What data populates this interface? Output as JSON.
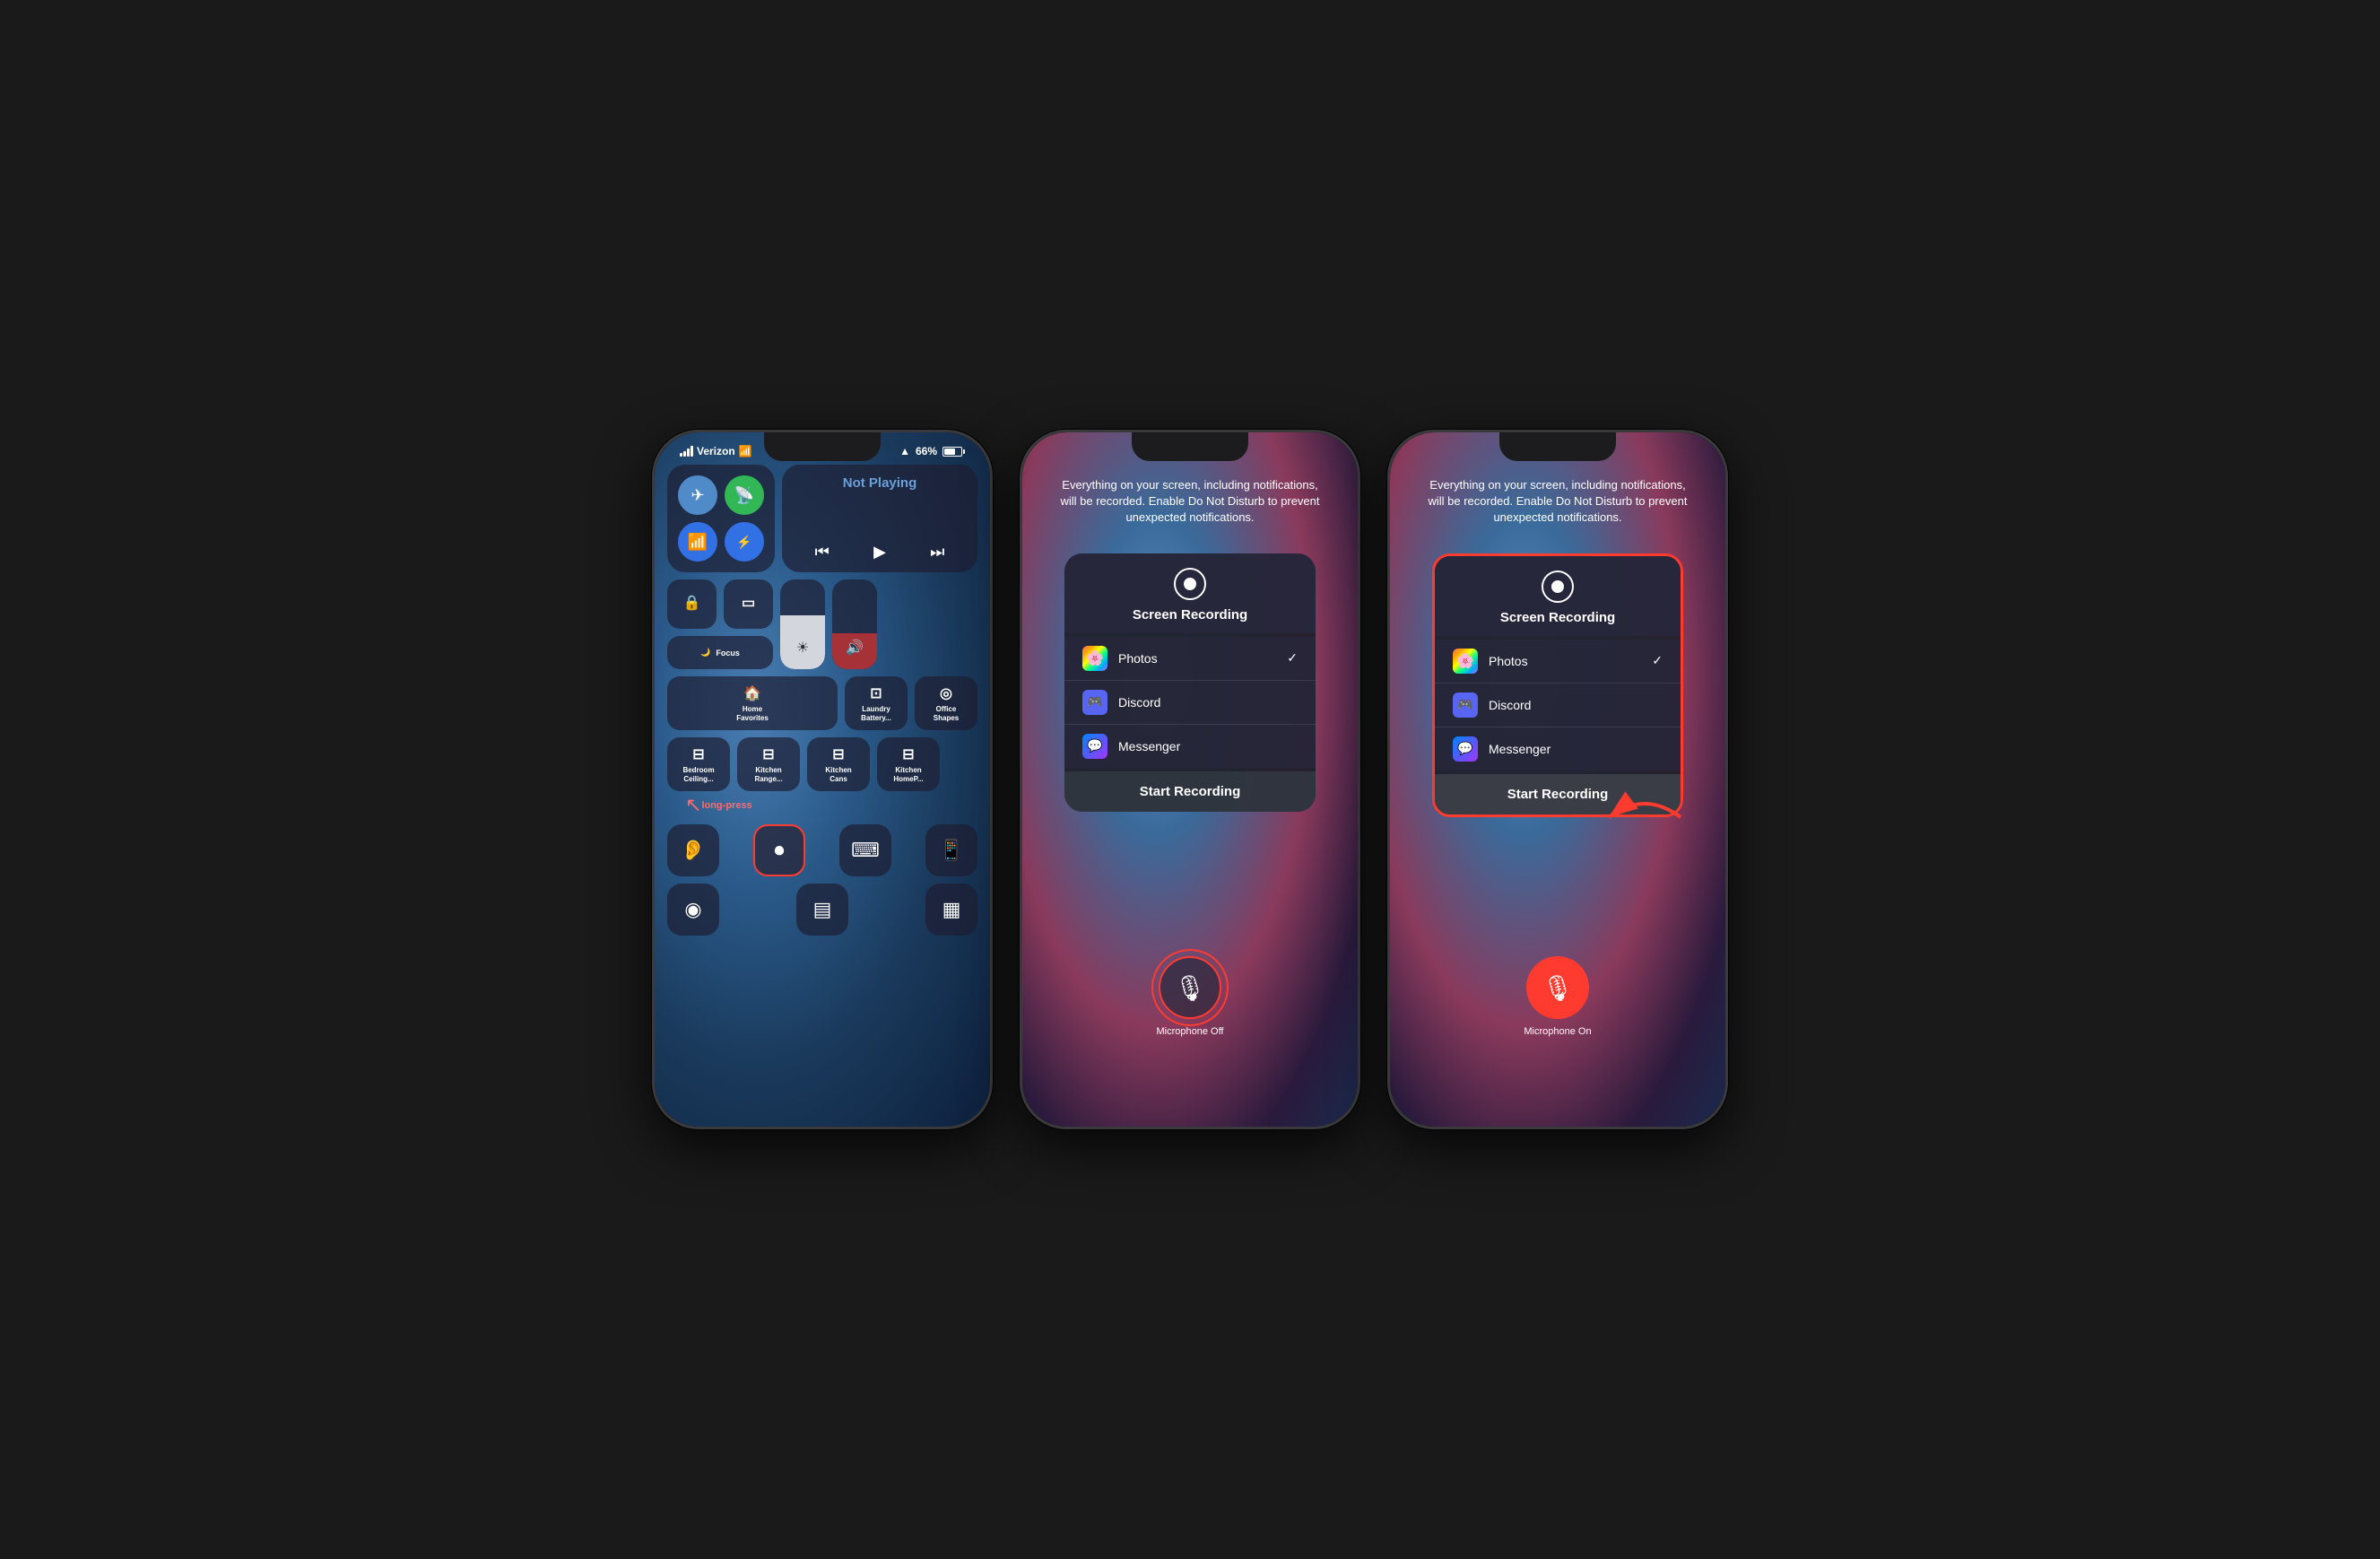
{
  "phones": [
    {
      "id": "phone1",
      "statusBar": {
        "carrier": "Verizon",
        "battery": "66%"
      },
      "controlCenter": {
        "mediaTitle": "Not Playing",
        "focusLabel": "Focus",
        "tiles": [
          {
            "id": "home",
            "icon": "🏠",
            "label": "Home\nFavorites"
          },
          {
            "id": "laundry",
            "icon": "⊡",
            "label": "Laundry\nBattery..."
          },
          {
            "id": "office",
            "icon": "◎",
            "label": "Office\nShapes"
          },
          {
            "id": "bedroom",
            "icon": "⊟",
            "label": "Bedroom\nCeiling..."
          },
          {
            "id": "kitchen-range",
            "icon": "⊟",
            "label": "Kitchen\nRange..."
          },
          {
            "id": "kitchen-cans",
            "icon": "⊟",
            "label": "Kitchen\nCans"
          },
          {
            "id": "kitchen-home",
            "icon": "⊟",
            "label": "Kitchen\nHomeP..."
          }
        ],
        "bottomIcons": [
          {
            "id": "hearing",
            "icon": "👂",
            "label": "hearing"
          },
          {
            "id": "record",
            "icon": "⏺",
            "label": "record",
            "highlighted": true
          },
          {
            "id": "calc",
            "icon": "⌨",
            "label": "calc"
          },
          {
            "id": "remote",
            "icon": "📱",
            "label": "remote"
          },
          {
            "id": "watchface",
            "icon": "◉",
            "label": "watchface"
          },
          {
            "id": "wallet",
            "icon": "▤",
            "label": "wallet"
          },
          {
            "id": "shortcuts",
            "icon": "▦",
            "label": "shortcuts"
          }
        ],
        "annotation": "long-press"
      }
    },
    {
      "id": "phone2",
      "infoText": "Everything on your screen, including notifications, will be recorded. Enable Do Not Disturb to prevent unexpected notifications.",
      "popup": {
        "title": "Screen Recording",
        "apps": [
          {
            "name": "Photos",
            "checked": true
          },
          {
            "name": "Discord",
            "checked": false
          },
          {
            "name": "Messenger",
            "checked": false
          }
        ],
        "startButton": "Start Recording"
      },
      "microphone": {
        "icon": "🎙",
        "label": "Microphone\nOff",
        "state": "off"
      }
    },
    {
      "id": "phone3",
      "infoText": "Everything on your screen, including notifications, will be recorded. Enable Do Not Disturb to prevent unexpected notifications.",
      "popup": {
        "title": "Screen Recording",
        "apps": [
          {
            "name": "Photos",
            "checked": true
          },
          {
            "name": "Discord",
            "checked": false
          },
          {
            "name": "Messenger",
            "checked": false
          }
        ],
        "startButton": "Start Recording",
        "highlighted": true
      },
      "microphone": {
        "icon": "🎙",
        "label": "Microphone\nOn",
        "state": "on"
      }
    }
  ]
}
